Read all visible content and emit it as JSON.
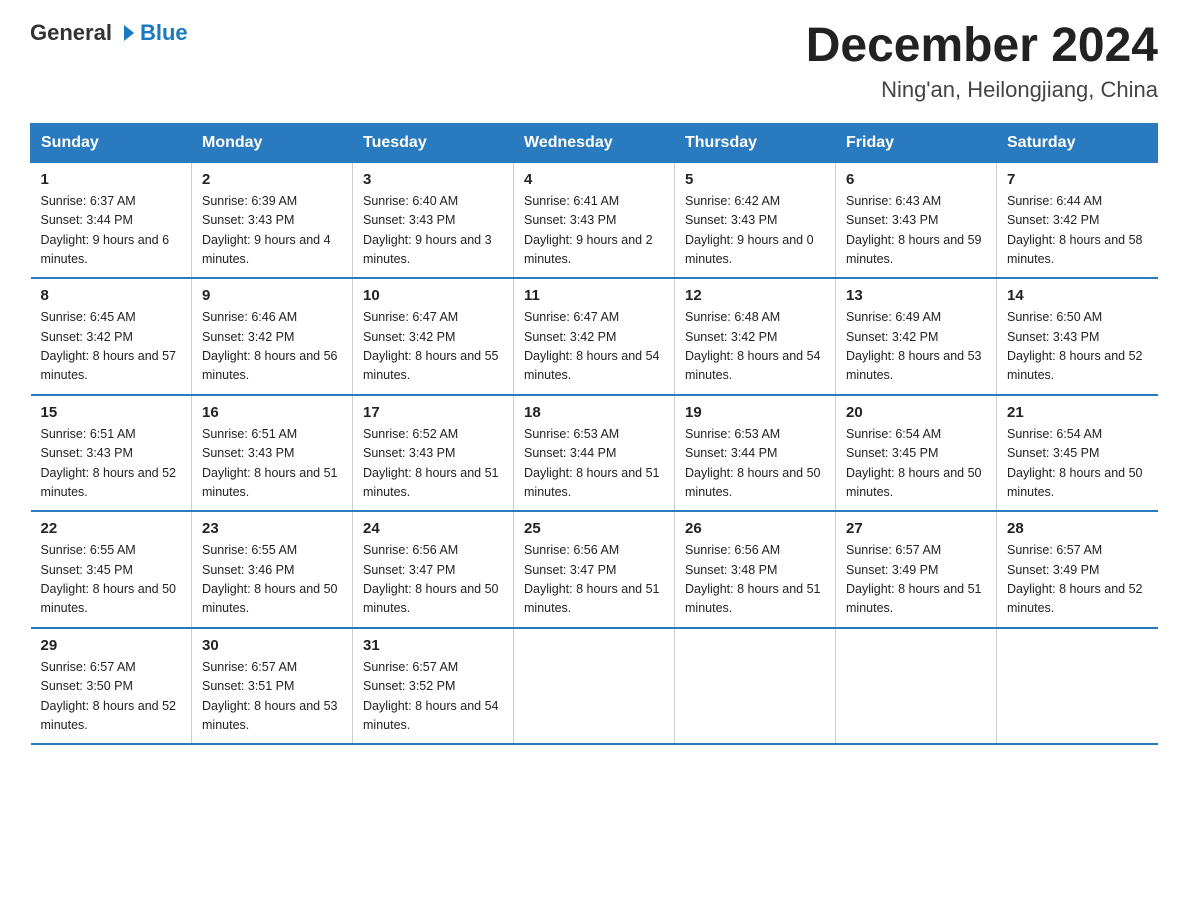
{
  "header": {
    "logo_general": "General",
    "logo_blue": "Blue",
    "title": "December 2024",
    "subtitle": "Ning'an, Heilongjiang, China"
  },
  "days_of_week": [
    "Sunday",
    "Monday",
    "Tuesday",
    "Wednesday",
    "Thursday",
    "Friday",
    "Saturday"
  ],
  "weeks": [
    [
      {
        "day": "1",
        "sunrise": "6:37 AM",
        "sunset": "3:44 PM",
        "daylight": "9 hours and 6 minutes."
      },
      {
        "day": "2",
        "sunrise": "6:39 AM",
        "sunset": "3:43 PM",
        "daylight": "9 hours and 4 minutes."
      },
      {
        "day": "3",
        "sunrise": "6:40 AM",
        "sunset": "3:43 PM",
        "daylight": "9 hours and 3 minutes."
      },
      {
        "day": "4",
        "sunrise": "6:41 AM",
        "sunset": "3:43 PM",
        "daylight": "9 hours and 2 minutes."
      },
      {
        "day": "5",
        "sunrise": "6:42 AM",
        "sunset": "3:43 PM",
        "daylight": "9 hours and 0 minutes."
      },
      {
        "day": "6",
        "sunrise": "6:43 AM",
        "sunset": "3:43 PM",
        "daylight": "8 hours and 59 minutes."
      },
      {
        "day": "7",
        "sunrise": "6:44 AM",
        "sunset": "3:42 PM",
        "daylight": "8 hours and 58 minutes."
      }
    ],
    [
      {
        "day": "8",
        "sunrise": "6:45 AM",
        "sunset": "3:42 PM",
        "daylight": "8 hours and 57 minutes."
      },
      {
        "day": "9",
        "sunrise": "6:46 AM",
        "sunset": "3:42 PM",
        "daylight": "8 hours and 56 minutes."
      },
      {
        "day": "10",
        "sunrise": "6:47 AM",
        "sunset": "3:42 PM",
        "daylight": "8 hours and 55 minutes."
      },
      {
        "day": "11",
        "sunrise": "6:47 AM",
        "sunset": "3:42 PM",
        "daylight": "8 hours and 54 minutes."
      },
      {
        "day": "12",
        "sunrise": "6:48 AM",
        "sunset": "3:42 PM",
        "daylight": "8 hours and 54 minutes."
      },
      {
        "day": "13",
        "sunrise": "6:49 AM",
        "sunset": "3:42 PM",
        "daylight": "8 hours and 53 minutes."
      },
      {
        "day": "14",
        "sunrise": "6:50 AM",
        "sunset": "3:43 PM",
        "daylight": "8 hours and 52 minutes."
      }
    ],
    [
      {
        "day": "15",
        "sunrise": "6:51 AM",
        "sunset": "3:43 PM",
        "daylight": "8 hours and 52 minutes."
      },
      {
        "day": "16",
        "sunrise": "6:51 AM",
        "sunset": "3:43 PM",
        "daylight": "8 hours and 51 minutes."
      },
      {
        "day": "17",
        "sunrise": "6:52 AM",
        "sunset": "3:43 PM",
        "daylight": "8 hours and 51 minutes."
      },
      {
        "day": "18",
        "sunrise": "6:53 AM",
        "sunset": "3:44 PM",
        "daylight": "8 hours and 51 minutes."
      },
      {
        "day": "19",
        "sunrise": "6:53 AM",
        "sunset": "3:44 PM",
        "daylight": "8 hours and 50 minutes."
      },
      {
        "day": "20",
        "sunrise": "6:54 AM",
        "sunset": "3:45 PM",
        "daylight": "8 hours and 50 minutes."
      },
      {
        "day": "21",
        "sunrise": "6:54 AM",
        "sunset": "3:45 PM",
        "daylight": "8 hours and 50 minutes."
      }
    ],
    [
      {
        "day": "22",
        "sunrise": "6:55 AM",
        "sunset": "3:45 PM",
        "daylight": "8 hours and 50 minutes."
      },
      {
        "day": "23",
        "sunrise": "6:55 AM",
        "sunset": "3:46 PM",
        "daylight": "8 hours and 50 minutes."
      },
      {
        "day": "24",
        "sunrise": "6:56 AM",
        "sunset": "3:47 PM",
        "daylight": "8 hours and 50 minutes."
      },
      {
        "day": "25",
        "sunrise": "6:56 AM",
        "sunset": "3:47 PM",
        "daylight": "8 hours and 51 minutes."
      },
      {
        "day": "26",
        "sunrise": "6:56 AM",
        "sunset": "3:48 PM",
        "daylight": "8 hours and 51 minutes."
      },
      {
        "day": "27",
        "sunrise": "6:57 AM",
        "sunset": "3:49 PM",
        "daylight": "8 hours and 51 minutes."
      },
      {
        "day": "28",
        "sunrise": "6:57 AM",
        "sunset": "3:49 PM",
        "daylight": "8 hours and 52 minutes."
      }
    ],
    [
      {
        "day": "29",
        "sunrise": "6:57 AM",
        "sunset": "3:50 PM",
        "daylight": "8 hours and 52 minutes."
      },
      {
        "day": "30",
        "sunrise": "6:57 AM",
        "sunset": "3:51 PM",
        "daylight": "8 hours and 53 minutes."
      },
      {
        "day": "31",
        "sunrise": "6:57 AM",
        "sunset": "3:52 PM",
        "daylight": "8 hours and 54 minutes."
      },
      null,
      null,
      null,
      null
    ]
  ]
}
